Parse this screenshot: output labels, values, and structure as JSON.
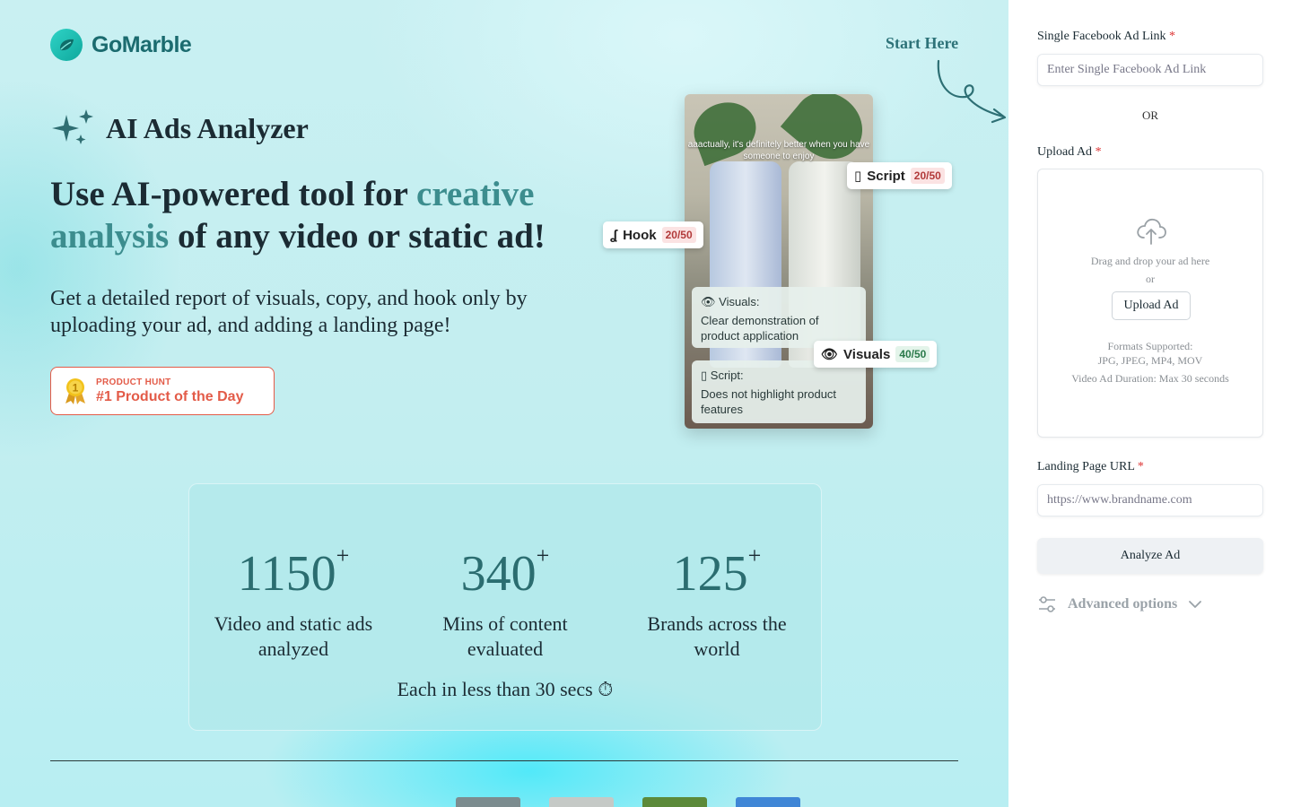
{
  "brand": {
    "name": "GoMarble"
  },
  "hero": {
    "start_here": "Start Here",
    "tool_title": "AI Ads Analyzer",
    "headline_pre": "Use AI-powered tool for ",
    "headline_accent": "creative analysis",
    "headline_post": " of any video or static ad!",
    "subline": "Get a detailed report of visuals, copy, and hook only by uploading your ad, and adding a landing page!",
    "badge": {
      "small": "PRODUCT HUNT",
      "big": "#1 Product of the Day",
      "medal_number": "1"
    }
  },
  "ad_preview": {
    "caption": "aaactually, it's definitely better when you have someone to enjoy",
    "chips": [
      {
        "label": "Script",
        "score": "20/50",
        "tone": "red"
      },
      {
        "label": "Hook",
        "score": "20/50",
        "tone": "red"
      },
      {
        "label": "Visuals",
        "score": "40/50",
        "tone": "green"
      }
    ],
    "cards": [
      {
        "title": "Visuals:",
        "body": "Clear demonstration of product application"
      },
      {
        "title": "Script:",
        "body": "Does not highlight product features"
      }
    ]
  },
  "stats": {
    "items": [
      {
        "value": "1150",
        "suffix": "+",
        "label": "Video and static ads analyzed"
      },
      {
        "value": "340",
        "suffix": "+",
        "label": "Mins of content evaluated"
      },
      {
        "value": "125",
        "suffix": "+",
        "label": "Brands across the world"
      }
    ],
    "footer": "Each in less than 30 secs ⏱"
  },
  "form": {
    "fb_link": {
      "label": "Single Facebook Ad Link",
      "required": "*",
      "placeholder": "Enter Single Facebook Ad Link",
      "value": ""
    },
    "or_text": "OR",
    "upload": {
      "label": "Upload Ad",
      "required": "*",
      "drag_text": "Drag and drop your ad here",
      "or_text": "or",
      "button": "Upload Ad",
      "formats_title": "Formats Supported:",
      "formats": "JPG, JPEG, MP4, MOV",
      "duration": "Video Ad Duration: Max 30 seconds"
    },
    "landing": {
      "label": "Landing Page URL",
      "required": "*",
      "placeholder": "https://www.brandname.com",
      "value": ""
    },
    "analyze_button": "Analyze Ad",
    "advanced": "Advanced options"
  },
  "colors": {
    "accent": "#3c8d8e",
    "badge": "#e35b48",
    "panel_bg": "#ffffff"
  },
  "icons": [
    "logo-leaf-icon",
    "sparkle-icon",
    "curly-arrow-icon",
    "medal-icon",
    "upload-cloud-icon",
    "sliders-icon",
    "chevron-down-icon",
    "document-icon",
    "eye-icon",
    "hook-icon"
  ]
}
